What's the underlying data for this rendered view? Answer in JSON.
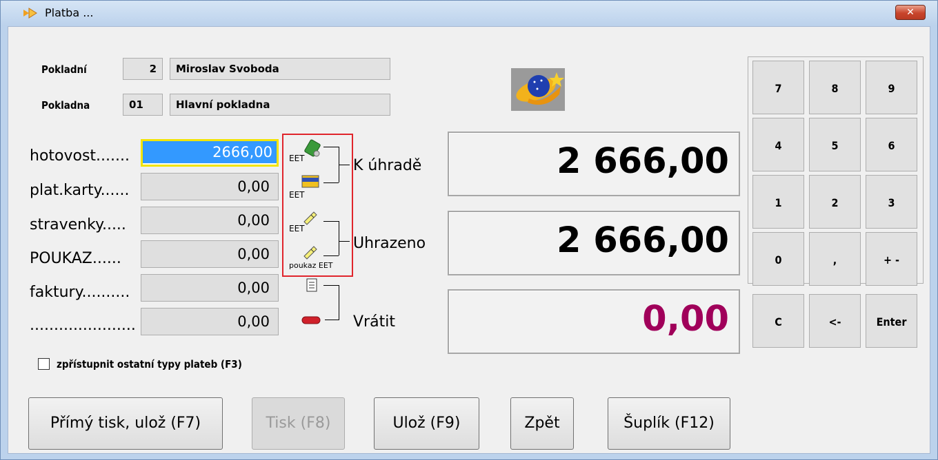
{
  "window": {
    "title": "Platba ...",
    "close_glyph": "✕"
  },
  "cashier": {
    "label": "Pokladní",
    "id": "2",
    "name": "Miroslav Svoboda"
  },
  "register": {
    "label": "Pokladna",
    "id": "01",
    "name": "Hlavní pokladna"
  },
  "payments": [
    {
      "label": "hotovost.......",
      "value": "2666,00",
      "active": true
    },
    {
      "label": "plat.karty......",
      "value": "0,00"
    },
    {
      "label": "stravenky.....",
      "value": "0,00"
    },
    {
      "label": "POUKAZ......",
      "value": "0,00"
    },
    {
      "label": "faktury..........",
      "value": "0,00"
    },
    {
      "label": "......................",
      "value": "0,00"
    }
  ],
  "payment_icons": [
    {
      "icon": "cash-icon",
      "caption": "EET"
    },
    {
      "icon": "bank-card-icon",
      "caption": "EET"
    },
    {
      "icon": "voucher-icon",
      "caption": "EET"
    },
    {
      "icon": "gift-voucher-icon",
      "caption": "poukaz EET"
    },
    {
      "icon": "invoice-icon",
      "caption": ""
    },
    {
      "icon": "minus-icon",
      "caption": ""
    }
  ],
  "totals": {
    "due_label": "K úhradě",
    "due_value": "2 666,00",
    "paid_label": "Uhrazeno",
    "paid_value": "2 666,00",
    "change_label": "Vrátit",
    "change_value": "0,00",
    "change_color": "#a0005a"
  },
  "numpad": [
    "7",
    "8",
    "9",
    "4",
    "5",
    "6",
    "1",
    "2",
    "3",
    "0",
    ",",
    "+ -",
    "C",
    "<-",
    "Enter"
  ],
  "checkbox": {
    "label": "zpřístupnit ostatní typy plateb (F3)",
    "checked": false
  },
  "buttons": {
    "direct_print": "Přímý tisk, ulož (F7)",
    "print": "Tisk (F8)",
    "save": "Ulož (F9)",
    "back": "Zpět",
    "drawer": "Šuplík (F12)"
  }
}
